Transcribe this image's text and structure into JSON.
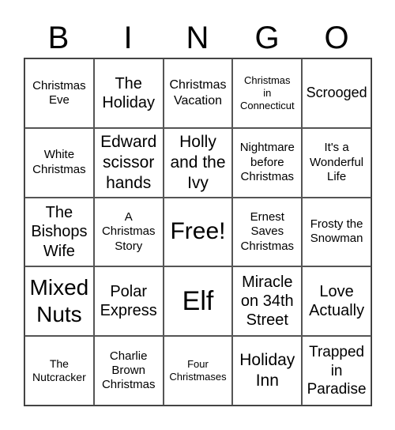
{
  "header": [
    "B",
    "I",
    "N",
    "G",
    "O"
  ],
  "cells": [
    {
      "text": "Christmas\nEve",
      "size": 15
    },
    {
      "text": "The\nHoliday",
      "size": 20
    },
    {
      "text": "Christmas\nVacation",
      "size": 16
    },
    {
      "text": "Christmas\nin\nConnecticut",
      "size": 13
    },
    {
      "text": "Scrooged",
      "size": 18
    },
    {
      "text": "White\nChristmas",
      "size": 15
    },
    {
      "text": "Edward\nscissor\nhands",
      "size": 21
    },
    {
      "text": "Holly\nand the\nIvy",
      "size": 21
    },
    {
      "text": "Nightmare\nbefore\nChristmas",
      "size": 15
    },
    {
      "text": "It's a\nWonderful\nLife",
      "size": 15
    },
    {
      "text": "The\nBishops\nWife",
      "size": 20
    },
    {
      "text": "A\nChristmas\nStory",
      "size": 15
    },
    {
      "text": "Free!",
      "size": 30
    },
    {
      "text": "Ernest\nSaves\nChristmas",
      "size": 15
    },
    {
      "text": "Frosty the\nSnowman",
      "size": 15
    },
    {
      "text": "Mixed\nNuts",
      "size": 28
    },
    {
      "text": "Polar\nExpress",
      "size": 20
    },
    {
      "text": "Elf",
      "size": 34
    },
    {
      "text": "Miracle\non 34th\nStreet",
      "size": 20
    },
    {
      "text": "Love\nActually",
      "size": 20
    },
    {
      "text": "The\nNutcracker",
      "size": 14
    },
    {
      "text": "Charlie\nBrown\nChristmas",
      "size": 15
    },
    {
      "text": "Four\nChristmases",
      "size": 13
    },
    {
      "text": "Holiday\nInn",
      "size": 21
    },
    {
      "text": "Trapped\nin\nParadise",
      "size": 19
    }
  ]
}
